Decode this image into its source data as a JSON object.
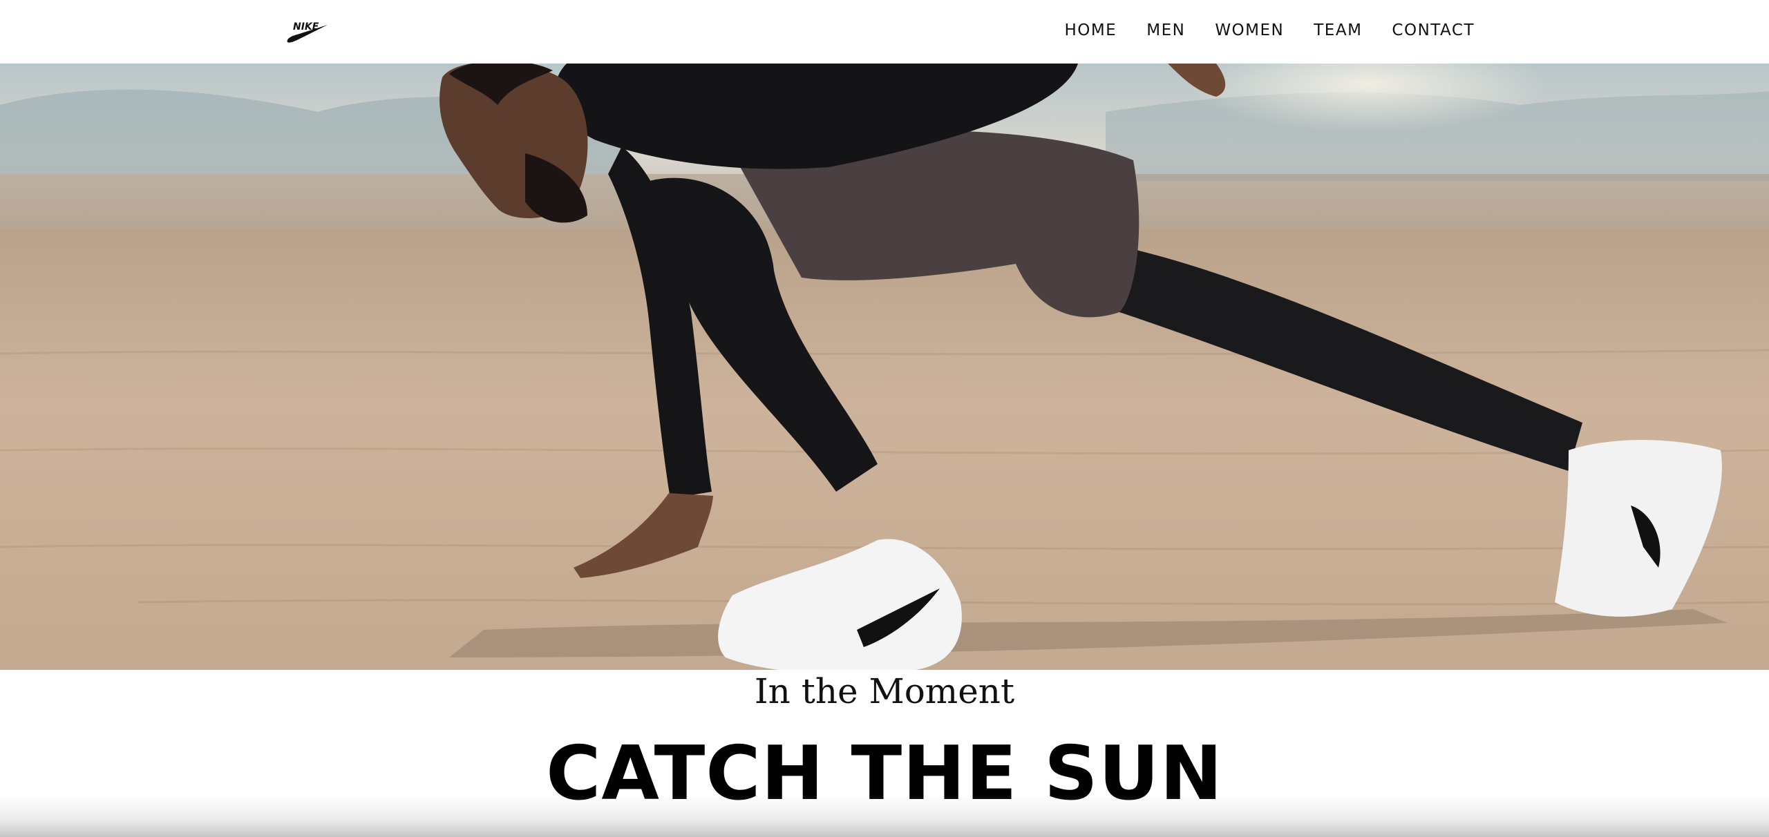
{
  "brand": {
    "logo_text": "NIKE",
    "logo_icon": "nike-swoosh-icon"
  },
  "nav": {
    "items": [
      {
        "label": "HOME"
      },
      {
        "label": "MEN"
      },
      {
        "label": "WOMEN"
      },
      {
        "label": "TEAM"
      },
      {
        "label": "CONTACT"
      }
    ]
  },
  "hero": {
    "image": "athlete-stretching-desert-photo",
    "sky_color": "#c9d3d2",
    "ground_color": "#c8ad93"
  },
  "section": {
    "subtitle": "In the Moment",
    "headline": "CATCH THE SUN"
  },
  "colors": {
    "text": "#111111",
    "background": "#ffffff"
  }
}
